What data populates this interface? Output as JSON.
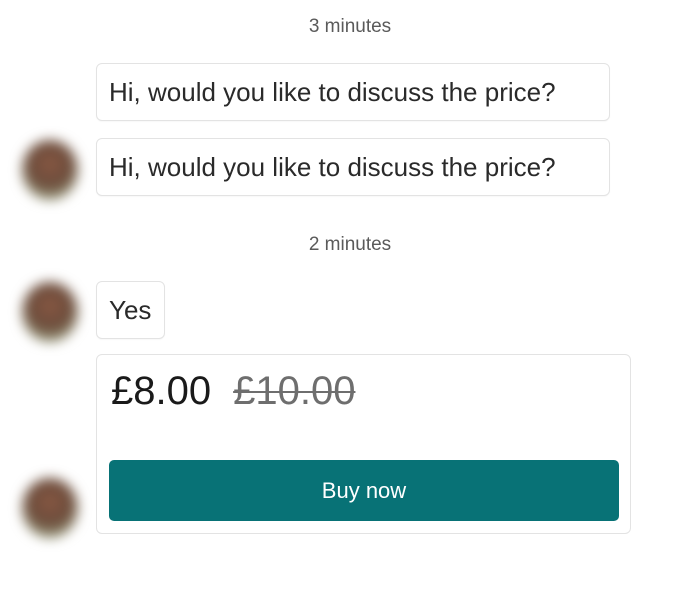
{
  "colors": {
    "accent": "#087276",
    "bubble_border": "#e3e3e3"
  },
  "messages": {
    "group1": {
      "time": "3 minutes",
      "first": "Hi, would you like to discuss the price?",
      "second": "Hi, would you like to discuss the price?"
    },
    "group2": {
      "time": "2 minutes",
      "reply": "Yes"
    }
  },
  "offer": {
    "price": "£8.00",
    "original_price": "£10.00",
    "buy_label": "Buy now"
  }
}
